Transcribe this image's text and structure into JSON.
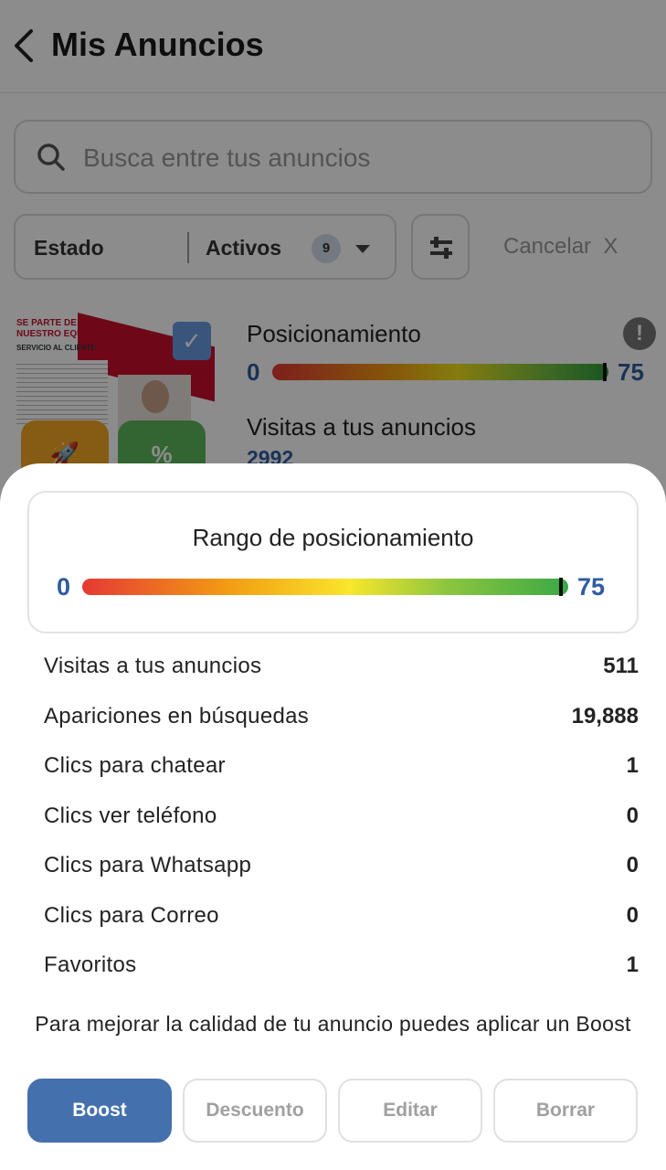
{
  "header": {
    "title": "Mis Anuncios"
  },
  "search": {
    "placeholder": "Busca entre tus anuncios"
  },
  "filter": {
    "label": "Estado",
    "value": "Activos",
    "count": "9",
    "cancel": "Cancelar  X"
  },
  "listing": {
    "thumb_line1": "SE PARTE DE",
    "thumb_line2": "NUESTRO EQUIPO!",
    "thumb_sub": "SERVICIO AL CLIENTE",
    "positioning_label": "Posicionamiento",
    "positioning_min": "0",
    "positioning_max": "75",
    "visits_label": "Visitas a tus anuncios",
    "visits_value": "2992"
  },
  "sheet": {
    "range_title": "Rango de posicionamiento",
    "range_min": "0",
    "range_max": "75",
    "stats": [
      {
        "label": "Visitas a tus anuncios",
        "value": "511"
      },
      {
        "label": "Apariciones en búsquedas",
        "value": "19,888"
      },
      {
        "label": "Clics para chatear",
        "value": "1"
      },
      {
        "label": "Clics ver teléfono",
        "value": "0"
      },
      {
        "label": "Clics para Whatsapp",
        "value": "0"
      },
      {
        "label": "Clics para Correo",
        "value": "0"
      },
      {
        "label": "Favoritos",
        "value": "1"
      }
    ],
    "tip": "Para mejorar la calidad de tu anuncio puedes aplicar un Boost",
    "buttons": {
      "boost": "Boost",
      "discount": "Descuento",
      "edit": "Editar",
      "delete": "Borrar"
    }
  },
  "colors": {
    "accent": "#4470ad",
    "value_blue": "#2f5d9e"
  },
  "icons": [
    "back-icon",
    "search-icon",
    "chevron-down-icon",
    "sliders-icon",
    "alert-icon",
    "check-icon",
    "rocket-icon",
    "percent-icon"
  ]
}
